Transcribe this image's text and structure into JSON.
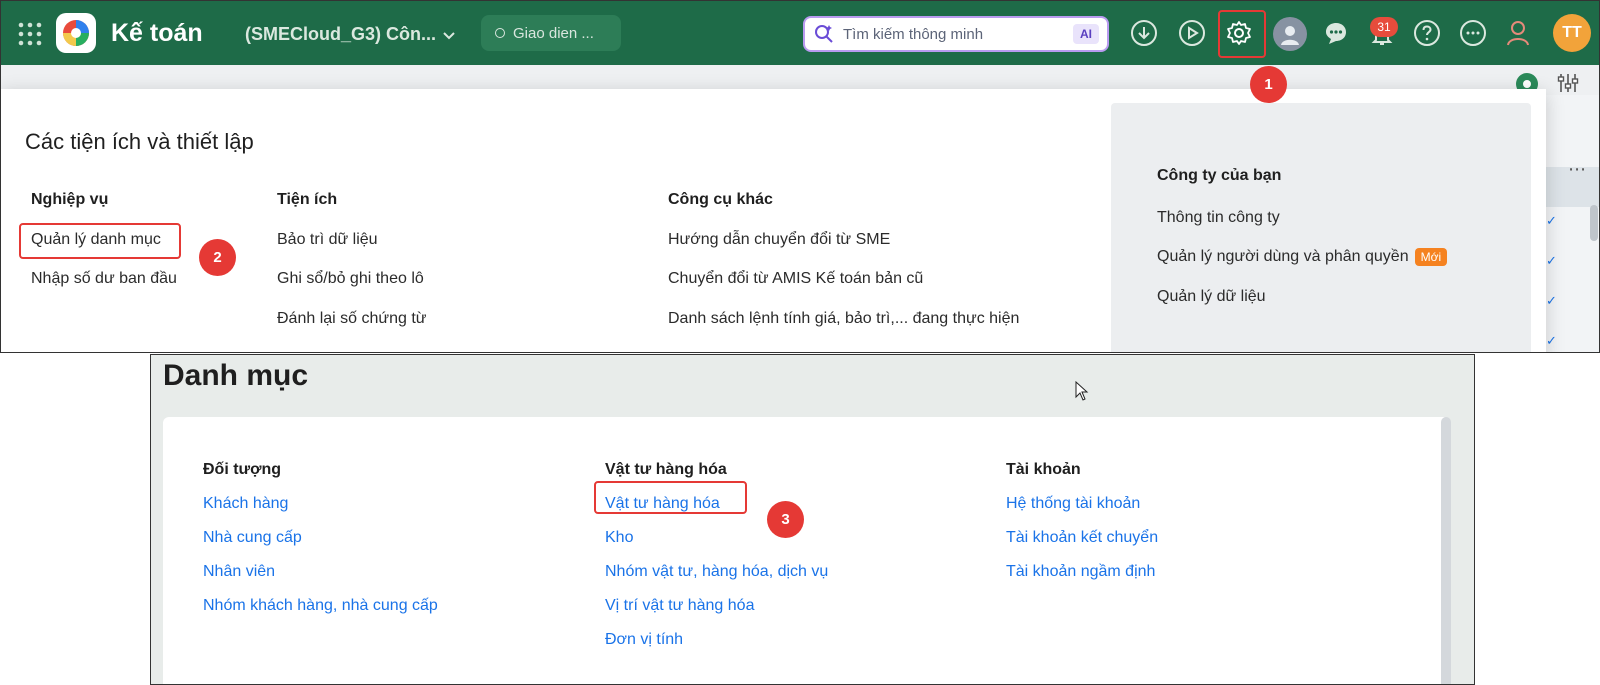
{
  "topbar": {
    "app_title": "Kế toán",
    "company": "(SMECloud_G3) Côn...",
    "ui_mode": "Giao dien ...",
    "search_placeholder": "Tìm kiếm thông minh",
    "ai_label": "AI",
    "notification_count": "31",
    "avatar_initials": "TT",
    "colors": {
      "bar": "#1e6b48",
      "highlight": "#e53935",
      "link": "#1a73e8"
    }
  },
  "steps": [
    "1",
    "2",
    "3"
  ],
  "settings_menu": {
    "title": "Các tiện ích và thiết lập",
    "columns": [
      {
        "header": "Nghiệp vụ",
        "items": [
          "Quản lý danh mục",
          "Nhập số dư ban đầu"
        ]
      },
      {
        "header": "Tiện ích",
        "items": [
          "Bảo trì dữ liệu",
          "Ghi sổ/bỏ ghi theo lô",
          "Đánh lại số chứng từ"
        ]
      },
      {
        "header": "Công cụ khác",
        "items": [
          "Hướng dẫn chuyển đổi từ SME",
          "Chuyển đổi từ AMIS Kế toán bản cũ",
          "Danh sách lệnh tính giá, bảo trì,... đang thực hiện"
        ]
      }
    ],
    "company_section": {
      "header": "Công ty của bạn",
      "items": [
        "Thông tin công ty",
        "Quản lý người dùng và phân quyền",
        "Quản lý dữ liệu"
      ],
      "new_badge": "Mới"
    }
  },
  "danh_muc": {
    "title": "Danh mục",
    "columns": [
      {
        "header": "Đối tượng",
        "items": [
          "Khách hàng",
          "Nhà cung cấp",
          "Nhân viên",
          "Nhóm khách hàng, nhà cung cấp"
        ]
      },
      {
        "header": "Vật tư hàng hóa",
        "items": [
          "Vật tư hàng hóa",
          "Kho",
          "Nhóm vật tư, hàng hóa, dịch vụ",
          "Vị trí vật tư hàng hóa",
          "Đơn vị tính"
        ]
      },
      {
        "header": "Tài khoản",
        "items": [
          "Hệ thống tài khoản",
          "Tài khoản kết chuyển",
          "Tài khoản ngầm định"
        ]
      }
    ]
  }
}
